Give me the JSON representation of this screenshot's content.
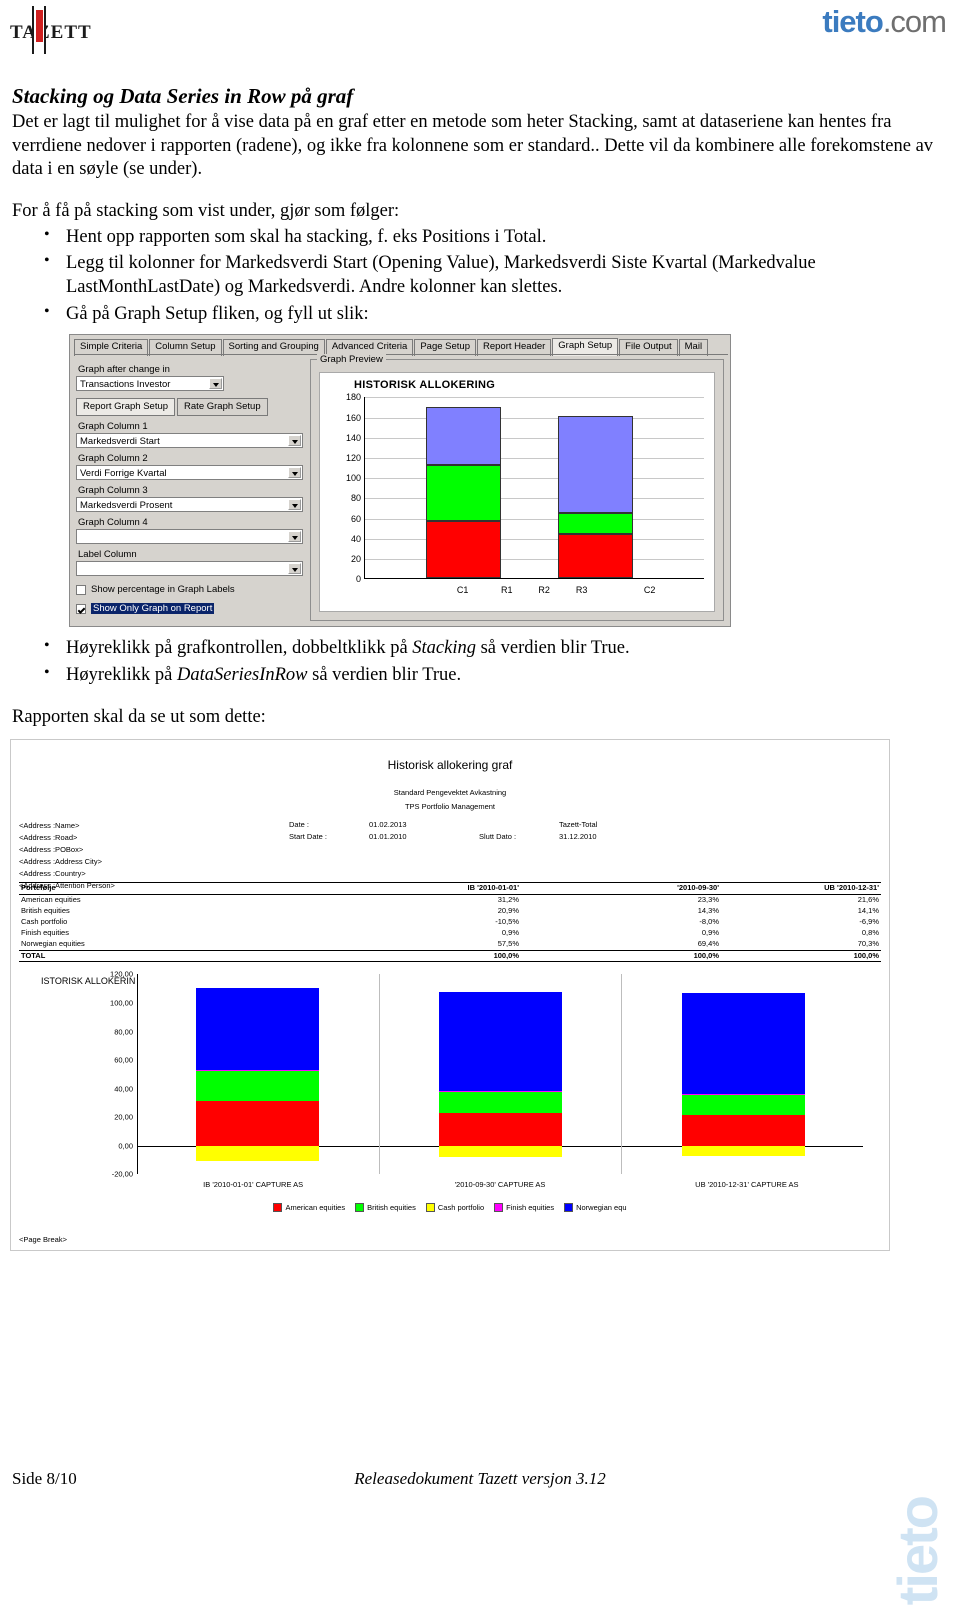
{
  "header": {
    "logo_left_text": "TAZETT",
    "logo_right_text": "tieto",
    "logo_right_suffix": ".com"
  },
  "document": {
    "title": "Stacking og Data Series in Row på graf",
    "intro": "Det er lagt til mulighet for å vise data på en graf etter en metode som heter Stacking, samt at dataseriene kan hentes fra verrdiene nedover i rapporten (radene), og ikke fra kolonnene som er standard.. Dette vil da kombinere alle forekomstene av data i en søyle (se under).",
    "lead_in": "For å få på stacking som vist under, gjør som følger:",
    "steps": [
      "Hent opp rapporten som skal ha stacking, f. eks Positions i Total.",
      "Legg til kolonner for Markedsverdi Start (Opening Value), Markedsverdi Siste Kvartal (Markedvalue LastMonthLastDate) og Markedsverdi. Andre kolonner kan slettes.",
      "Gå på Graph Setup fliken, og fyll ut slik:"
    ],
    "steps_after": [
      "Høyreklikk på grafkontrollen, dobbeltklikk på Stacking så verdien blir True.",
      "Høyreklikk på DataSeriesInRow så verdien blir True."
    ],
    "closing": "Rapporten skal da se ut som dette:"
  },
  "dialog": {
    "tabs": [
      "Simple Criteria",
      "Column Setup",
      "Sorting and Grouping",
      "Advanced Criteria",
      "Page Setup",
      "Report Header",
      "Graph Setup",
      "File Output",
      "Mail"
    ],
    "active_tab": "Graph Setup",
    "graph_after_change_label": "Graph after change in",
    "graph_after_change_value": "Transactions Investor",
    "subtabs": [
      "Report Graph Setup",
      "Rate Graph Setup"
    ],
    "active_subtab": "Report Graph Setup",
    "columns": [
      {
        "label": "Graph Column 1",
        "value": "Markedsverdi Start"
      },
      {
        "label": "Graph Column 2",
        "value": "Verdi Forrige Kvartal"
      },
      {
        "label": "Graph Column 3",
        "value": "Markedsverdi Prosent"
      },
      {
        "label": "Graph Column 4",
        "value": ""
      }
    ],
    "label_column_label": "Label Column",
    "label_column_value": "",
    "checkbox_percentage": "Show percentage in Graph Labels",
    "checkbox_percentage_checked": false,
    "checkbox_only_graph": "Show Only Graph on Report",
    "checkbox_only_graph_checked": true,
    "preview_group_label": "Graph Preview"
  },
  "chart_data": [
    {
      "type": "bar",
      "id": "graph-preview-chart",
      "title": "HISTORISK ALLOKERING",
      "stacked": true,
      "categories": [
        "C1",
        "C2"
      ],
      "xtick_extra": [
        "R1",
        "R2",
        "R3"
      ],
      "ylim": [
        0,
        180
      ],
      "yticks": [
        0,
        20,
        40,
        60,
        80,
        100,
        120,
        140,
        160,
        180
      ],
      "series": [
        {
          "name": "segment-red",
          "color": "#ff0000",
          "values": [
            57,
            44
          ]
        },
        {
          "name": "segment-green",
          "color": "#00ff00",
          "values": [
            55,
            21
          ]
        },
        {
          "name": "segment-blue",
          "color": "#8080ff",
          "values": [
            58,
            96
          ]
        }
      ],
      "grid": true,
      "legend": "none"
    },
    {
      "type": "bar",
      "id": "report-allocation-chart",
      "title": "ISTORISK ALLOKERIN",
      "stacked": true,
      "categories": [
        "IB '2010-01-01' CAPTURE AS",
        "'2010-09-30' CAPTURE AS",
        "UB '2010-12-31' CAPTURE AS"
      ],
      "ylim": [
        -20,
        120
      ],
      "yticks": [
        120.0,
        100.0,
        80.0,
        60.0,
        40.0,
        20.0,
        0.0,
        -20.0
      ],
      "ytick_labels": [
        "120,00",
        "100,00",
        "80,00",
        "60,00",
        "40,00",
        "20,00",
        "0,00",
        "-20,00"
      ],
      "series": [
        {
          "name": "American equities",
          "color": "#ff0000",
          "values": [
            31.2,
            23.3,
            21.6
          ]
        },
        {
          "name": "British equities",
          "color": "#00ff00",
          "values": [
            20.9,
            14.3,
            14.1
          ]
        },
        {
          "name": "Cash portfolio",
          "color": "#ffff00",
          "values": [
            -10.5,
            -8.0,
            -6.9
          ]
        },
        {
          "name": "Finish equities",
          "color": "#ff00ff",
          "values": [
            0.9,
            0.9,
            0.8
          ]
        },
        {
          "name": "Norwegian equ",
          "color": "#0000ff",
          "values": [
            57.5,
            69.4,
            70.3
          ]
        }
      ],
      "legend": "bottom",
      "legend_items": [
        "American equities",
        "British equities",
        "Cash portfolio",
        "Finish equities",
        "Norwegian equ"
      ]
    }
  ],
  "report": {
    "title": "Historisk allokering graf",
    "subtitle1": "Standard Pengevektet Avkastning",
    "subtitle2": "TPS Portfolio Management",
    "address_lines": [
      "<Address :Name>",
      "<Address :Road>",
      "<Address :POBox>",
      "<Address :Address City>",
      "<Address :Country>",
      "<Address :Attention Person>"
    ],
    "meta": [
      {
        "label": "Date :",
        "value": "01.02.2013"
      },
      {
        "label": "Start Date :",
        "value": "01.01.2010"
      },
      {
        "label": "Slutt Dato :",
        "value": "31.12.2010"
      },
      {
        "label": "Tazett-Total",
        "value": ""
      }
    ],
    "table": {
      "headers": [
        "Portefølje",
        "IB '2010-01-01'",
        "'2010-09-30'",
        "UB '2010-12-31'"
      ],
      "rows": [
        {
          "name": "American equities",
          "v1": "31,2%",
          "v2": "23,3%",
          "v3": "21,6%"
        },
        {
          "name": "British equities",
          "v1": "20,9%",
          "v2": "14,3%",
          "v3": "14,1%"
        },
        {
          "name": "Cash portfolio",
          "v1": "-10,5%",
          "v2": "-8,0%",
          "v3": "-6,9%"
        },
        {
          "name": "Finish equities",
          "v1": "0,9%",
          "v2": "0,9%",
          "v3": "0,8%"
        },
        {
          "name": "Norwegian equities",
          "v1": "57,5%",
          "v2": "69,4%",
          "v3": "70,3%"
        }
      ],
      "total": {
        "name": "TOTAL",
        "v1": "100,0%",
        "v2": "100,0%",
        "v3": "100,0%"
      }
    },
    "page_break": "<Page Break>"
  },
  "footer": {
    "page": "Side 8/10",
    "doc": "Releasedokument Tazett versjon 3.12"
  }
}
